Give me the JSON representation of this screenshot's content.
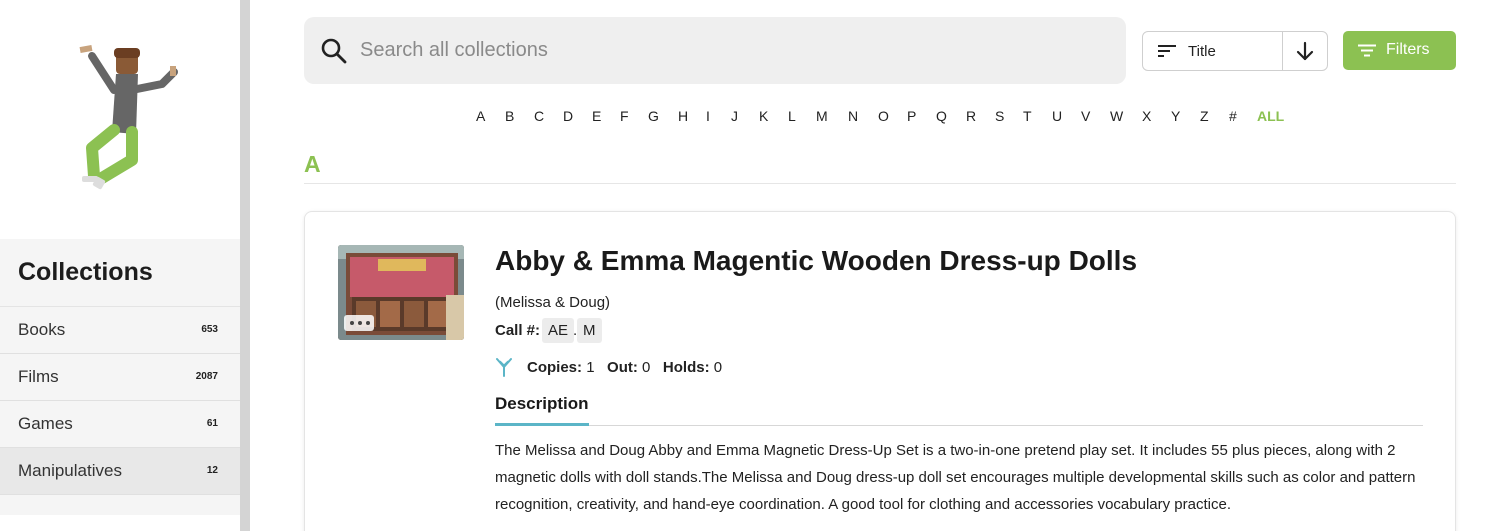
{
  "sidebar": {
    "collections_title": "Collections",
    "items": [
      {
        "label": "Books",
        "count": "653"
      },
      {
        "label": "Films",
        "count": "2087"
      },
      {
        "label": "Games",
        "count": "61"
      },
      {
        "label": "Manipulatives",
        "count": "12"
      }
    ],
    "active_item": "Manipulatives"
  },
  "search": {
    "placeholder": "Search all collections",
    "value": ""
  },
  "sort": {
    "field_label": "Title",
    "direction_icon": "arrow-down-icon"
  },
  "filters": {
    "label": "Filters"
  },
  "alphabet": [
    "A",
    "B",
    "C",
    "D",
    "E",
    "F",
    "G",
    "H",
    "I",
    "J",
    "K",
    "L",
    "M",
    "N",
    "O",
    "P",
    "Q",
    "R",
    "S",
    "T",
    "U",
    "V",
    "W",
    "X",
    "Y",
    "Z",
    "#",
    "ALL"
  ],
  "section": {
    "letter": "A"
  },
  "item": {
    "title": "Abby & Emma Magentic Wooden Dress-up Dolls",
    "publisher": "(Melissa & Doug)",
    "call_label": "Call #:",
    "call_parts": [
      "AE",
      ".",
      "M"
    ],
    "copies_label": "Copies:",
    "copies": "1",
    "out_label": "Out:",
    "out": "0",
    "holds_label": "Holds:",
    "holds": "0",
    "tab_label": "Description",
    "description": "The Melissa and Doug Abby and Emma Magnetic Dress-Up Set is a two-in-one pretend play set. It includes 55 plus pieces, along with 2 magnetic dolls with doll stands.The Melissa and Doug dress-up doll set encourages multiple developmental skills such as color and pattern recognition, creativity, and hand-eye coordination. A good tool for clothing and accessories vocabulary practice."
  },
  "colors": {
    "accent_green": "#8cc152",
    "tab_underline": "#5bb5c7",
    "sidebar_divider": "#d4d4d4"
  }
}
